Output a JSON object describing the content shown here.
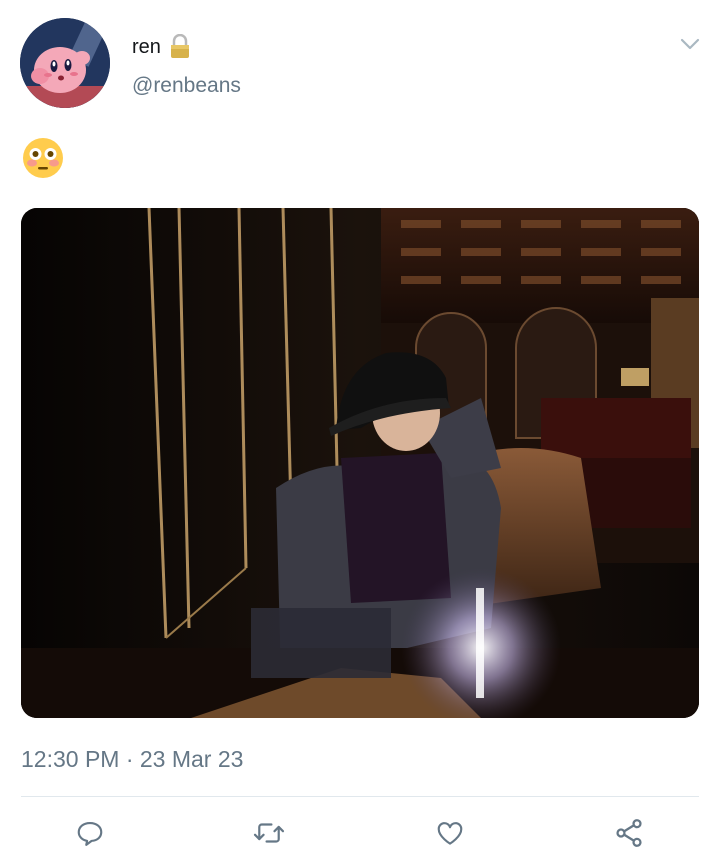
{
  "user": {
    "display_name": "ren",
    "handle": "@renbeans",
    "protected_icon": "lock-icon",
    "avatar_icon": "kirby-avatar"
  },
  "tweet": {
    "text_emoji": "flushed-face-emoji",
    "media_alt": "person in bucket hat seated in dark lounge",
    "timestamp": "12:30 PM · 23 Mar 23"
  },
  "actions": [
    {
      "icon": "reply-icon"
    },
    {
      "icon": "retweet-icon"
    },
    {
      "icon": "like-icon"
    },
    {
      "icon": "share-icon"
    }
  ],
  "colors": {
    "secondary_text": "#657786",
    "icon_gray": "#657786",
    "divider": "#e1e8ed"
  }
}
